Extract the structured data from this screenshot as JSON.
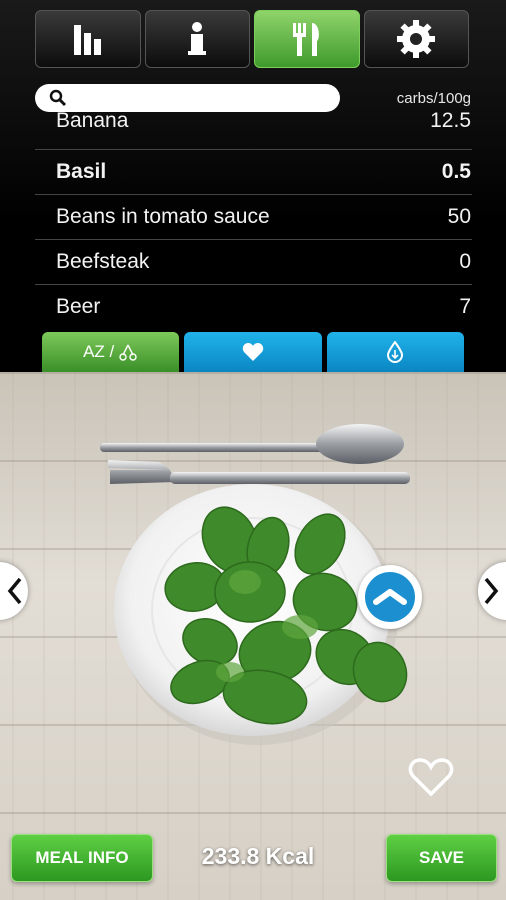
{
  "tabs": [
    {
      "icon": "bar-chart-icon",
      "active": false
    },
    {
      "icon": "info-icon",
      "active": false
    },
    {
      "icon": "fork-knife-icon",
      "active": true
    },
    {
      "icon": "gear-icon",
      "active": false
    }
  ],
  "search": {
    "value": "",
    "placeholder": ""
  },
  "unit_label": "carbs/100g",
  "foods": [
    {
      "name": "Banana",
      "value": "12.5"
    },
    {
      "name": "Basil",
      "value": "0.5",
      "selected": true
    },
    {
      "name": "Beans in tomato sauce",
      "value": "50"
    },
    {
      "name": "Beefsteak",
      "value": "0"
    },
    {
      "name": "Beer",
      "value": "7"
    }
  ],
  "filters": {
    "az_label": "AZ /",
    "az_icon": "cherries-icon",
    "favorites_icon": "heart-icon",
    "drop_icon": "drop-icon"
  },
  "meal": {
    "kcal": "233.8 Kcal",
    "food_icon": "basil-plate"
  },
  "buttons": {
    "meal_info": "MEAL INFO",
    "save": "SAVE"
  },
  "colors": {
    "green": "#4caf2f",
    "blue": "#1aa3dc",
    "circle_accent": "#1b8fd0"
  }
}
